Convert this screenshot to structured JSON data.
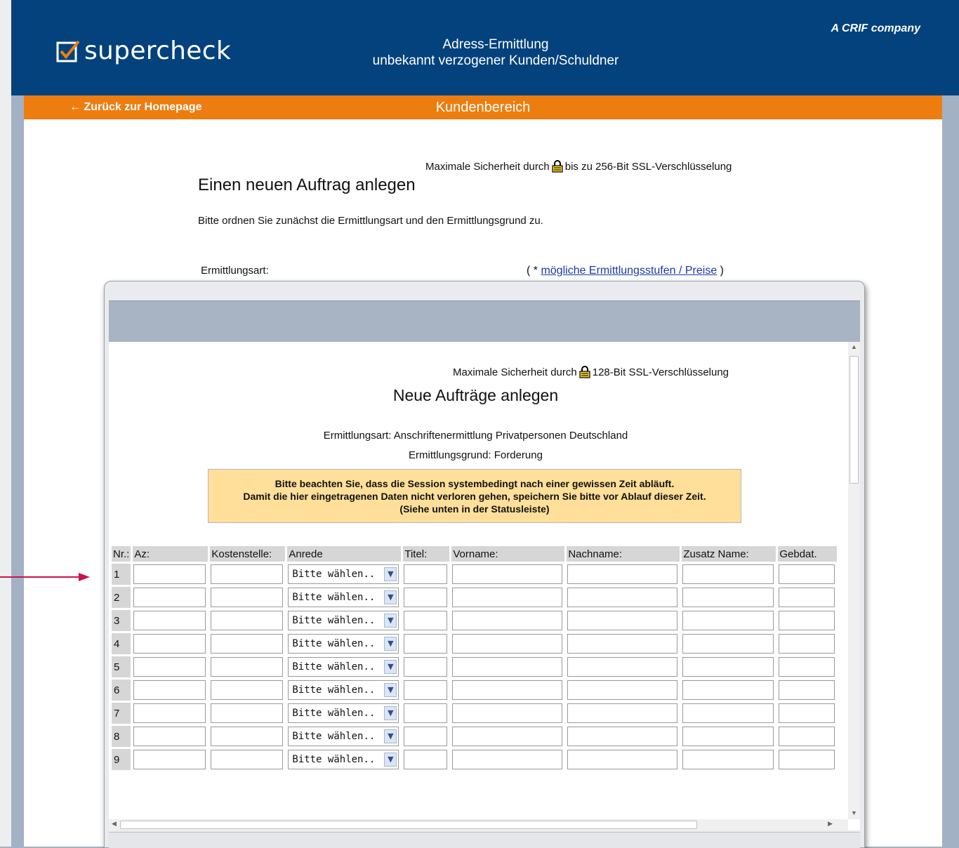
{
  "header": {
    "logo_text": "supercheck",
    "title_line1": "Adress-Ermittlung",
    "title_line2": "unbekannt verzogener Kunden/Schuldner",
    "crif": "A CRIF company"
  },
  "nav": {
    "back_link": "← Zurück zur Homepage",
    "section": "Kundenbereich"
  },
  "main": {
    "security_pre": "Maximale Sicherheit durch",
    "security_post": "bis zu 256-Bit SSL-Verschlüsselung",
    "heading": "Einen neuen Auftrag anlegen",
    "intro": "Bitte ordnen Sie zunächst die Ermittlungsart und den Ermittlungsgrund zu.",
    "ermittlungsart_label": "Ermittlungsart:",
    "preise_prefix": "( * ",
    "preise_link": "mögliche Ermittlungsstufen / Preise",
    "preise_suffix": " )"
  },
  "modal": {
    "security_pre": "Maximale Sicherheit durch",
    "security_post": "128-Bit SSL-Verschlüsselung",
    "heading": "Neue Aufträge anlegen",
    "ermittlungsart": "Ermittlungsart: Anschriftenermittlung Privatpersonen Deutschland",
    "ermittlungsgrund": "Ermittlungsgrund: Forderung",
    "notice_line1": "Bitte beachten Sie, dass die Session systembedingt nach einer gewissen Zeit abläuft.",
    "notice_line2": "Damit die hier eingetragenen Daten nicht verloren gehen, speichern Sie bitte vor Ablauf dieser Zeit.",
    "notice_line3": "(Siehe unten in der Statusleiste)",
    "columns": [
      "Nr.:",
      "Az:",
      "Kostenstelle:",
      "Anrede",
      "Titel:",
      "Vorname:",
      "Nachname:",
      "Zusatz Name:",
      "Gebdat."
    ],
    "rows": [
      "1",
      "2",
      "3",
      "4",
      "5",
      "6",
      "7",
      "8",
      "9"
    ],
    "select_placeholder": "Bitte wählen.."
  },
  "colors": {
    "header_blue": "#03427c",
    "nav_orange": "#ee7d10",
    "notice_yellow": "#ffdf99",
    "link_blue": "#1a3aa8",
    "arrow_red": "#d0104c"
  }
}
